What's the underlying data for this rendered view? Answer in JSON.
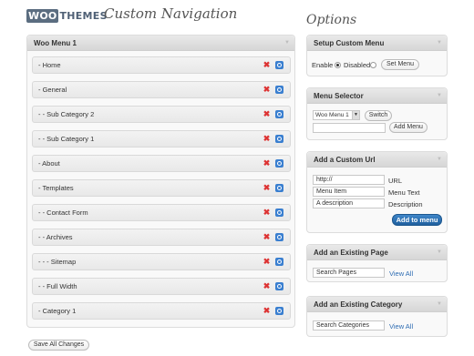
{
  "header": {
    "logo_woo": "WOO",
    "logo_themes": "THEMES",
    "title": "Custom Navigation",
    "options_title": "Options"
  },
  "menu_panel": {
    "title": "Woo Menu 1",
    "items": [
      {
        "label": "- Home"
      },
      {
        "label": "- General"
      },
      {
        "label": "- - Sub Category 2"
      },
      {
        "label": "- - Sub Category 1"
      },
      {
        "label": "- About"
      },
      {
        "label": "- Templates"
      },
      {
        "label": "- - Contact Form"
      },
      {
        "label": "- - Archives"
      },
      {
        "label": "- - - Sitemap"
      },
      {
        "label": "- - Full Width"
      },
      {
        "label": "- Category 1"
      }
    ],
    "delete_icon": "delete-icon",
    "edit_icon": "edit-icon"
  },
  "save_button": "Save All Changes",
  "setup": {
    "title": "Setup Custom Menu",
    "enable": "Enable",
    "disabled": "Disabled",
    "selected": "Enable",
    "set_menu": "Set Menu"
  },
  "selector": {
    "title": "Menu Selector",
    "selected_menu": "Woo Menu 1",
    "switch": "Switch",
    "new_menu_value": "",
    "add_menu": "Add Menu"
  },
  "custom_url": {
    "title": "Add a Custom Url",
    "url_value": "http://",
    "url_label": "URL",
    "text_value": "Menu Item",
    "text_label": "Menu Text",
    "desc_value": "A description",
    "desc_label": "Description",
    "add_button": "Add to menu"
  },
  "existing_page": {
    "title": "Add an Existing Page",
    "search_value": "Search Pages",
    "view_all": "View All"
  },
  "existing_category": {
    "title": "Add an Existing Category",
    "search_value": "Search Categories",
    "view_all": "View All"
  },
  "colors": {
    "accent_blue": "#2f6db3",
    "delete_red": "#dd3333",
    "primary_button": "#2a6fb0"
  }
}
